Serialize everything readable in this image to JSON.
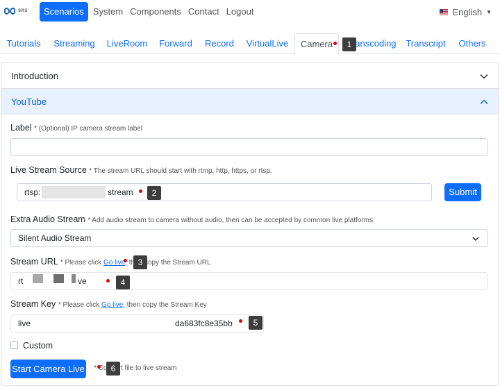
{
  "navbar": {
    "logo_text": "SRS",
    "links": [
      "Scenarios",
      "System",
      "Components",
      "Contact",
      "Logout"
    ],
    "language": "English"
  },
  "tabs": [
    "Tutorials",
    "Streaming",
    "LiveRoom",
    "Forward",
    "Record",
    "VirtualLive",
    "Camera",
    "Transcoding",
    "Transcript",
    "Others"
  ],
  "accordion": {
    "introduction": "Introduction",
    "youtube": "YouTube"
  },
  "form": {
    "label_title": "Label",
    "label_hint": "* (Optional) IP camera stream label",
    "label_value": "",
    "source_title": "Live Stream Source",
    "source_hint": "* The stream URL should start with rtmp, http, https, or rtsp.",
    "source_value_start": "rtsp:",
    "source_value_end": "stream",
    "submit": "Submit",
    "audio_title": "Extra Audio Stream",
    "audio_hint": "* Add audio stream to camera without audio, then can be accepted by common live platforms",
    "audio_selected": "Silent Audio Stream",
    "url_title": "Stream URL",
    "url_hint_pre": "* Please click",
    "url_hint_link": "Go live",
    "url_hint_post": ", then copy the Stream URL",
    "url_value_start": "rt",
    "url_value_end": "ve",
    "key_title": "Stream Key",
    "key_hint_pre": "* Please click",
    "key_hint_link": "Go live",
    "key_hint_post": ", then copy the Stream Key",
    "key_value_start": "live",
    "key_value_end": "da683fc8e35bb",
    "custom_label": "Custom",
    "start_button": "Start Camera Live",
    "start_hint": "* Convert file to live stream"
  },
  "markers": [
    "1",
    "2",
    "3",
    "4",
    "5",
    "6"
  ]
}
